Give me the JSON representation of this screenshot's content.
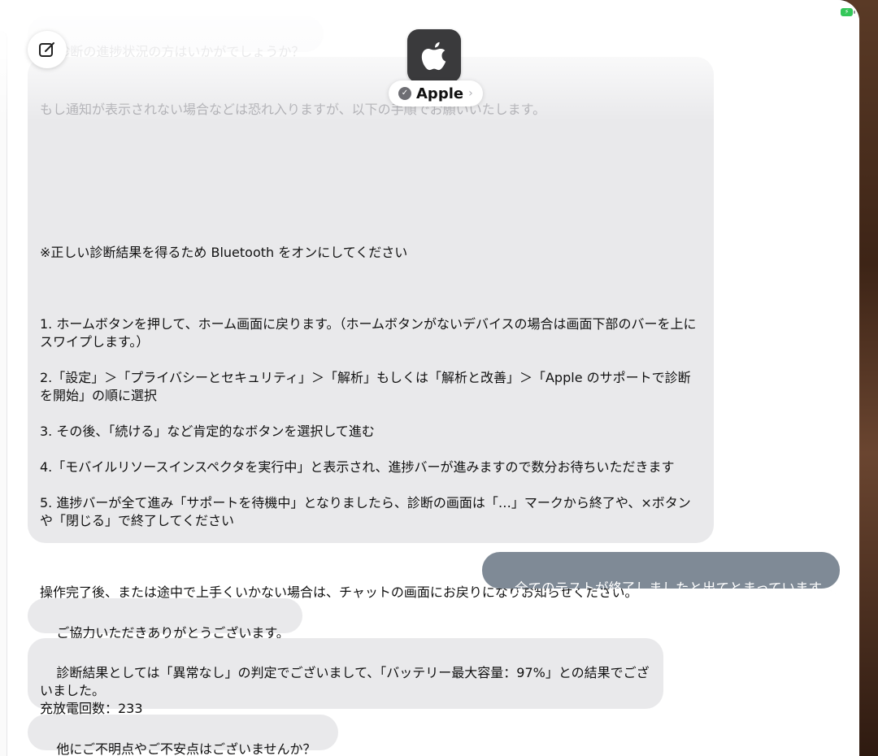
{
  "header": {
    "contact_name": "Apple",
    "verified_glyph": "✓",
    "chevron_glyph": "›"
  },
  "status": {
    "battery_glyph": "⚡"
  },
  "messages": {
    "faded_1": "診断の進捗状況の方はいかがでしょうか？",
    "faded_2": "もし通知が表示されない場合などは恐れ入りますが、以下の手順でお願いいたします。",
    "instructions": "※正しい診断結果を得るため Bluetooth をオンにしてください\n\n\n\n1. ホームボタンを押して、ホーム画面に戻ります。（ホームボタンがないデバイスの場合は画面下部のバーを上にスワイプします。）\n\n2.「設定」＞「プライバシーとセキュリティ」＞「解析」もしくは「解析と改善」＞「Apple のサポートで診断を開始」の順に選択\n\n3. その後、「続ける」など肯定的なボタンを選択して進む\n\n4.「モバイルリソースインスペクタを実行中」と表示され、進捗バーが進みますので数分お待ちいただきます\n\n5. 進捗バーが全て進み「サポートを待機中」となりましたら、診断の画面は「…」マークから終了や、×ボタンや「閉じる」で終了してください\n\n\n\n操作完了後、または途中で上手くいかない場合は、チャットの画面にお戻りになりお知らせください。",
    "outgoing": "全てのテストが終了しましたと出てとまっています",
    "thanks": "ご協力いただきありがとうございます。",
    "result": "診断結果としては「異常なし」の判定でございまして、「バッテリー最大容量：97%」との結果でございました。\n充放電回数：233",
    "question": "他にご不明点やご不安点はございませんか？"
  }
}
